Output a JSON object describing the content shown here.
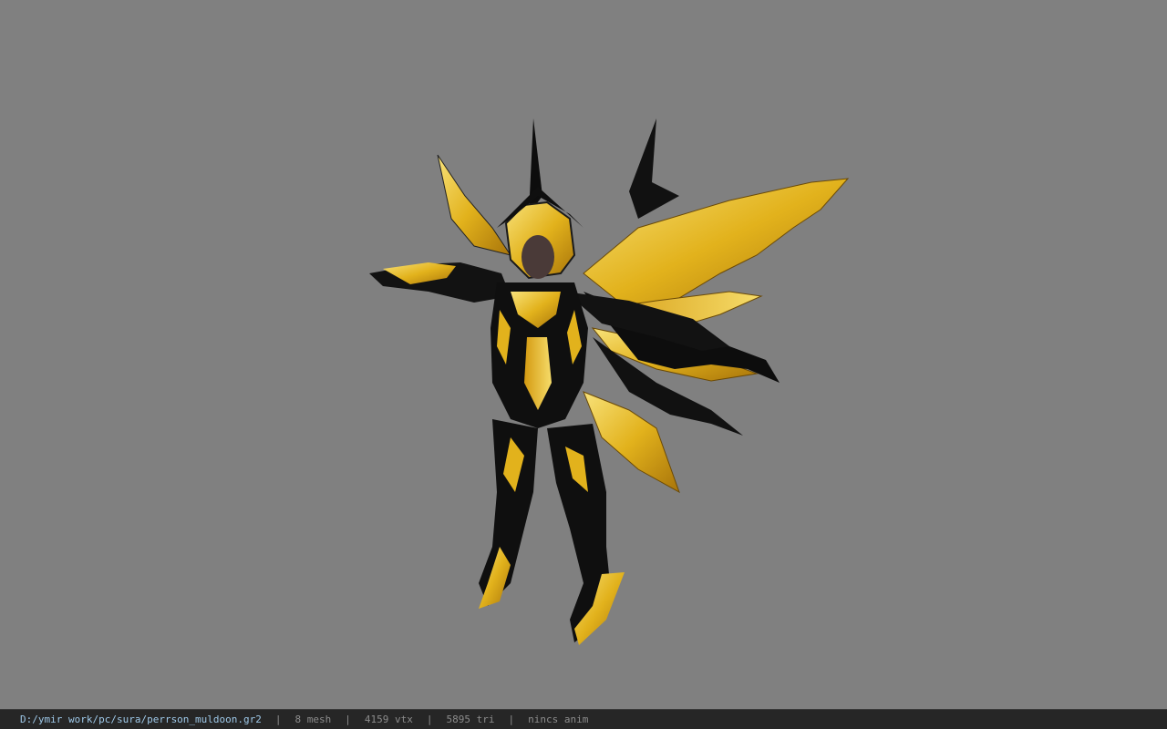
{
  "viewer": {
    "background_color": "#808080",
    "model_icon": "armored-character-model"
  },
  "status_bar": {
    "file_path": "D:/ymir work/pc/sura/perrson_muldoon.gr2",
    "separator": "|",
    "mesh": "8 mesh",
    "vertices": "4159 vtx",
    "triangles": "5895 tri",
    "animation": "nincs anim",
    "path_color": "#9ec8e8",
    "text_color": "#8c8c8c"
  }
}
